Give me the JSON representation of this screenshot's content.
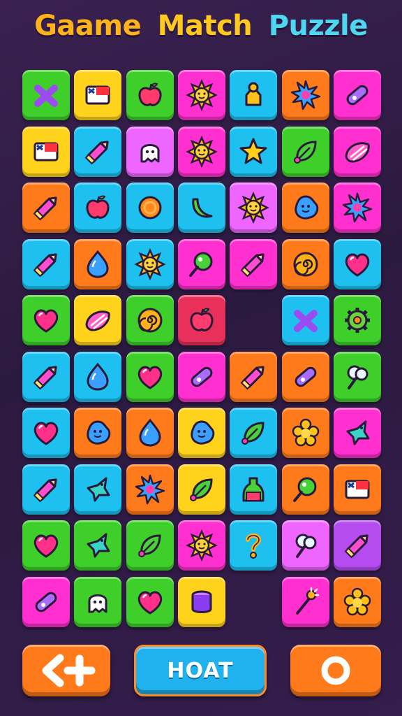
{
  "title": {
    "words": [
      {
        "text": "Gaame",
        "color": "#ffb21a"
      },
      {
        "text": "Match",
        "color": "#ffc81e"
      },
      {
        "text": "Puzzle",
        "color": "#4fd6f0"
      }
    ]
  },
  "board": {
    "rows": [
      [
        {
          "color": "#3ecf2a",
          "icon": "cross"
        },
        {
          "color": "#ffd21c",
          "icon": "flag"
        },
        {
          "color": "#3ecf2a",
          "icon": "apple"
        },
        {
          "color": "#ff2fd0",
          "icon": "sun"
        },
        {
          "color": "#1ec0f0",
          "icon": "house"
        },
        {
          "color": "#ff7a1a",
          "icon": "starburst"
        },
        {
          "color": "#ff2fd0",
          "icon": "candy"
        }
      ],
      [
        {
          "color": "#ffd21c",
          "icon": "flag"
        },
        {
          "color": "#1ec0f0",
          "icon": "pencil"
        },
        {
          "color": "#ee66ff",
          "icon": "ghost"
        },
        {
          "color": "#ff2fd0",
          "icon": "sun"
        },
        {
          "color": "#1ec0f0",
          "icon": "star"
        },
        {
          "color": "#3ecf2a",
          "icon": "leaf"
        },
        {
          "color": "#ff2fd0",
          "icon": "shell"
        }
      ],
      [
        {
          "color": "#ff7a1a",
          "icon": "pencil"
        },
        {
          "color": "#1ec0f0",
          "icon": "apple"
        },
        {
          "color": "#1ec0f0",
          "icon": "circle"
        },
        {
          "color": "#1ec0f0",
          "icon": "banana"
        },
        {
          "color": "#ee66ff",
          "icon": "sun"
        },
        {
          "color": "#ff7a1a",
          "icon": "blob"
        },
        {
          "color": "#ff2fd0",
          "icon": "starburst"
        }
      ],
      [
        {
          "color": "#1ec0f0",
          "icon": "pencil"
        },
        {
          "color": "#ff7a1a",
          "icon": "drop"
        },
        {
          "color": "#1ec0f0",
          "icon": "sun"
        },
        {
          "color": "#ff2fd0",
          "icon": "lollipop"
        },
        {
          "color": "#ff2fd0",
          "icon": "pencil"
        },
        {
          "color": "#ff7a1a",
          "icon": "swirl"
        },
        {
          "color": "#1ec0f0",
          "icon": "heart"
        }
      ],
      [
        {
          "color": "#3ecf2a",
          "icon": "heart"
        },
        {
          "color": "#ffd21c",
          "icon": "shell"
        },
        {
          "color": "#3ecf2a",
          "icon": "swirl"
        },
        {
          "color": "#e8305a",
          "icon": "apple"
        },
        null,
        {
          "color": "#1ec0f0",
          "icon": "cross"
        },
        {
          "color": "#3ecf2a",
          "icon": "gear"
        }
      ],
      [
        {
          "color": "#1ec0f0",
          "icon": "pencil"
        },
        {
          "color": "#1ec0f0",
          "icon": "drop"
        },
        {
          "color": "#3ecf2a",
          "icon": "heart"
        },
        {
          "color": "#ff2fd0",
          "icon": "candy"
        },
        {
          "color": "#ff7a1a",
          "icon": "pencil"
        },
        {
          "color": "#ff7a1a",
          "icon": "candy"
        },
        {
          "color": "#3ecf2a",
          "icon": "cotton"
        }
      ],
      [
        {
          "color": "#1ec0f0",
          "icon": "heart"
        },
        {
          "color": "#ff7a1a",
          "icon": "blob"
        },
        {
          "color": "#ff7a1a",
          "icon": "drop"
        },
        {
          "color": "#ffd21c",
          "icon": "blob"
        },
        {
          "color": "#1ec0f0",
          "icon": "leaf"
        },
        {
          "color": "#ff7a1a",
          "icon": "flower"
        },
        {
          "color": "#ff2fd0",
          "icon": "bird"
        }
      ],
      [
        {
          "color": "#1ec0f0",
          "icon": "pencil"
        },
        {
          "color": "#1ec0f0",
          "icon": "bird"
        },
        {
          "color": "#ff7a1a",
          "icon": "starburst"
        },
        {
          "color": "#ffd21c",
          "icon": "leaf"
        },
        {
          "color": "#1ec0f0",
          "icon": "bottle"
        },
        {
          "color": "#ff7a1a",
          "icon": "lollipop"
        },
        {
          "color": "#ff7a1a",
          "icon": "flag"
        }
      ],
      [
        {
          "color": "#3ecf2a",
          "icon": "heart"
        },
        {
          "color": "#3ecf2a",
          "icon": "bird"
        },
        {
          "color": "#3ecf2a",
          "icon": "leaf"
        },
        {
          "color": "#ff2fd0",
          "icon": "sun"
        },
        {
          "color": "#1ec0f0",
          "icon": "question"
        },
        {
          "color": "#ee66ff",
          "icon": "cotton"
        },
        {
          "color": "#b44cf0",
          "icon": "pencil"
        }
      ],
      [
        {
          "color": "#ff2fd0",
          "icon": "candy"
        },
        {
          "color": "#3ecf2a",
          "icon": "ghost"
        },
        {
          "color": "#3ecf2a",
          "icon": "heart"
        },
        {
          "color": "#ffd21c",
          "icon": "cup"
        },
        null,
        {
          "color": "#ff2fd0",
          "icon": "wand"
        },
        {
          "color": "#ff7a1a",
          "icon": "flower"
        }
      ]
    ]
  },
  "controls": {
    "back_icon": "back-plus-icon",
    "middle_label": "HOAT",
    "restart_icon": "ring-icon"
  }
}
